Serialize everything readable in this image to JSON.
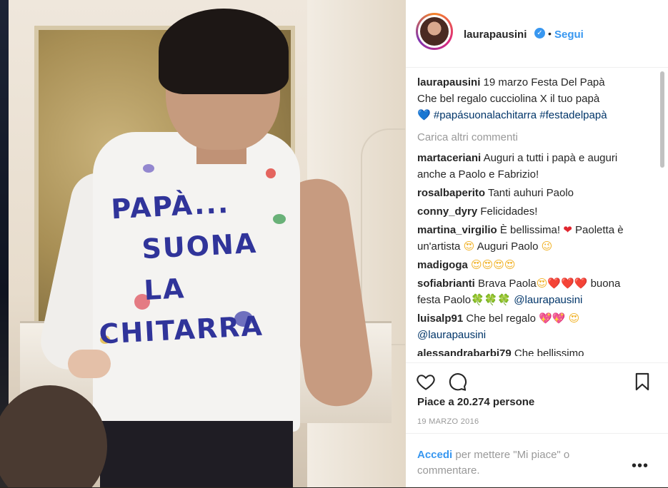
{
  "header": {
    "username": "laurapausini",
    "verified_icon": "verified-badge-icon",
    "separator": "•",
    "follow_label": "Segui"
  },
  "caption": {
    "username": "laurapausini",
    "text_line1": "19 marzo Festa Del Papà",
    "text_line2": "Che bel regalo cucciolina X il tuo papà",
    "emoji": "💙",
    "hashtags": "#papásuonalachitarra #festadelpapà"
  },
  "load_more": "Carica altri commenti",
  "comments": [
    {
      "user": "martaceriani",
      "text": "Auguri a tutti i papà e auguri anche a Paolo e Fabrizio!"
    },
    {
      "user": "rosalbaperito",
      "text": "Tanti auhuri Paolo"
    },
    {
      "user": "conny_dyry",
      "text": "Felicidades!"
    },
    {
      "user": "martina_virgilio",
      "text_a": "È bellissima!",
      "heart": "❤",
      "text_b": "Paoletta è un'artista",
      "emoji1": "😍",
      "text_c": "Auguri Paolo",
      "emoji2": "😉"
    },
    {
      "user": "madigoga",
      "emojis": "😍😍😍😍"
    },
    {
      "user": "sofiabrianti",
      "text_a": "Brava Paola",
      "emoji1": "😍",
      "hearts": "❤️❤️❤️",
      "text_b": "buona festa Paolo",
      "clovers": "🍀🍀🍀",
      "mention": "@laurapausini"
    },
    {
      "user": "luisalp91",
      "text": "Che bel regalo",
      "emojis": "💖💖",
      "emoji2": "😍",
      "mention": "@laurapausini"
    },
    {
      "user": "alessandrabarbi79",
      "text": "Che bellissimo"
    }
  ],
  "actions": {
    "like_icon": "heart-outline-icon",
    "comment_icon": "comment-bubble-icon",
    "save_icon": "bookmark-icon"
  },
  "likes_text": "Piace a 20.274 persone",
  "date": "19 MARZO 2016",
  "login": {
    "link": "Accedi",
    "rest": "per mettere \"Mi piace\" o commentare.",
    "more": "•••"
  },
  "photo": {
    "shirt_lines": [
      "PAPÀ...",
      "SUONA",
      "LA",
      "CHITARRA"
    ]
  },
  "colors": {
    "accent": "#3897f0",
    "text": "#262626",
    "muted": "#999999",
    "shirt_ink": "#30349a"
  }
}
